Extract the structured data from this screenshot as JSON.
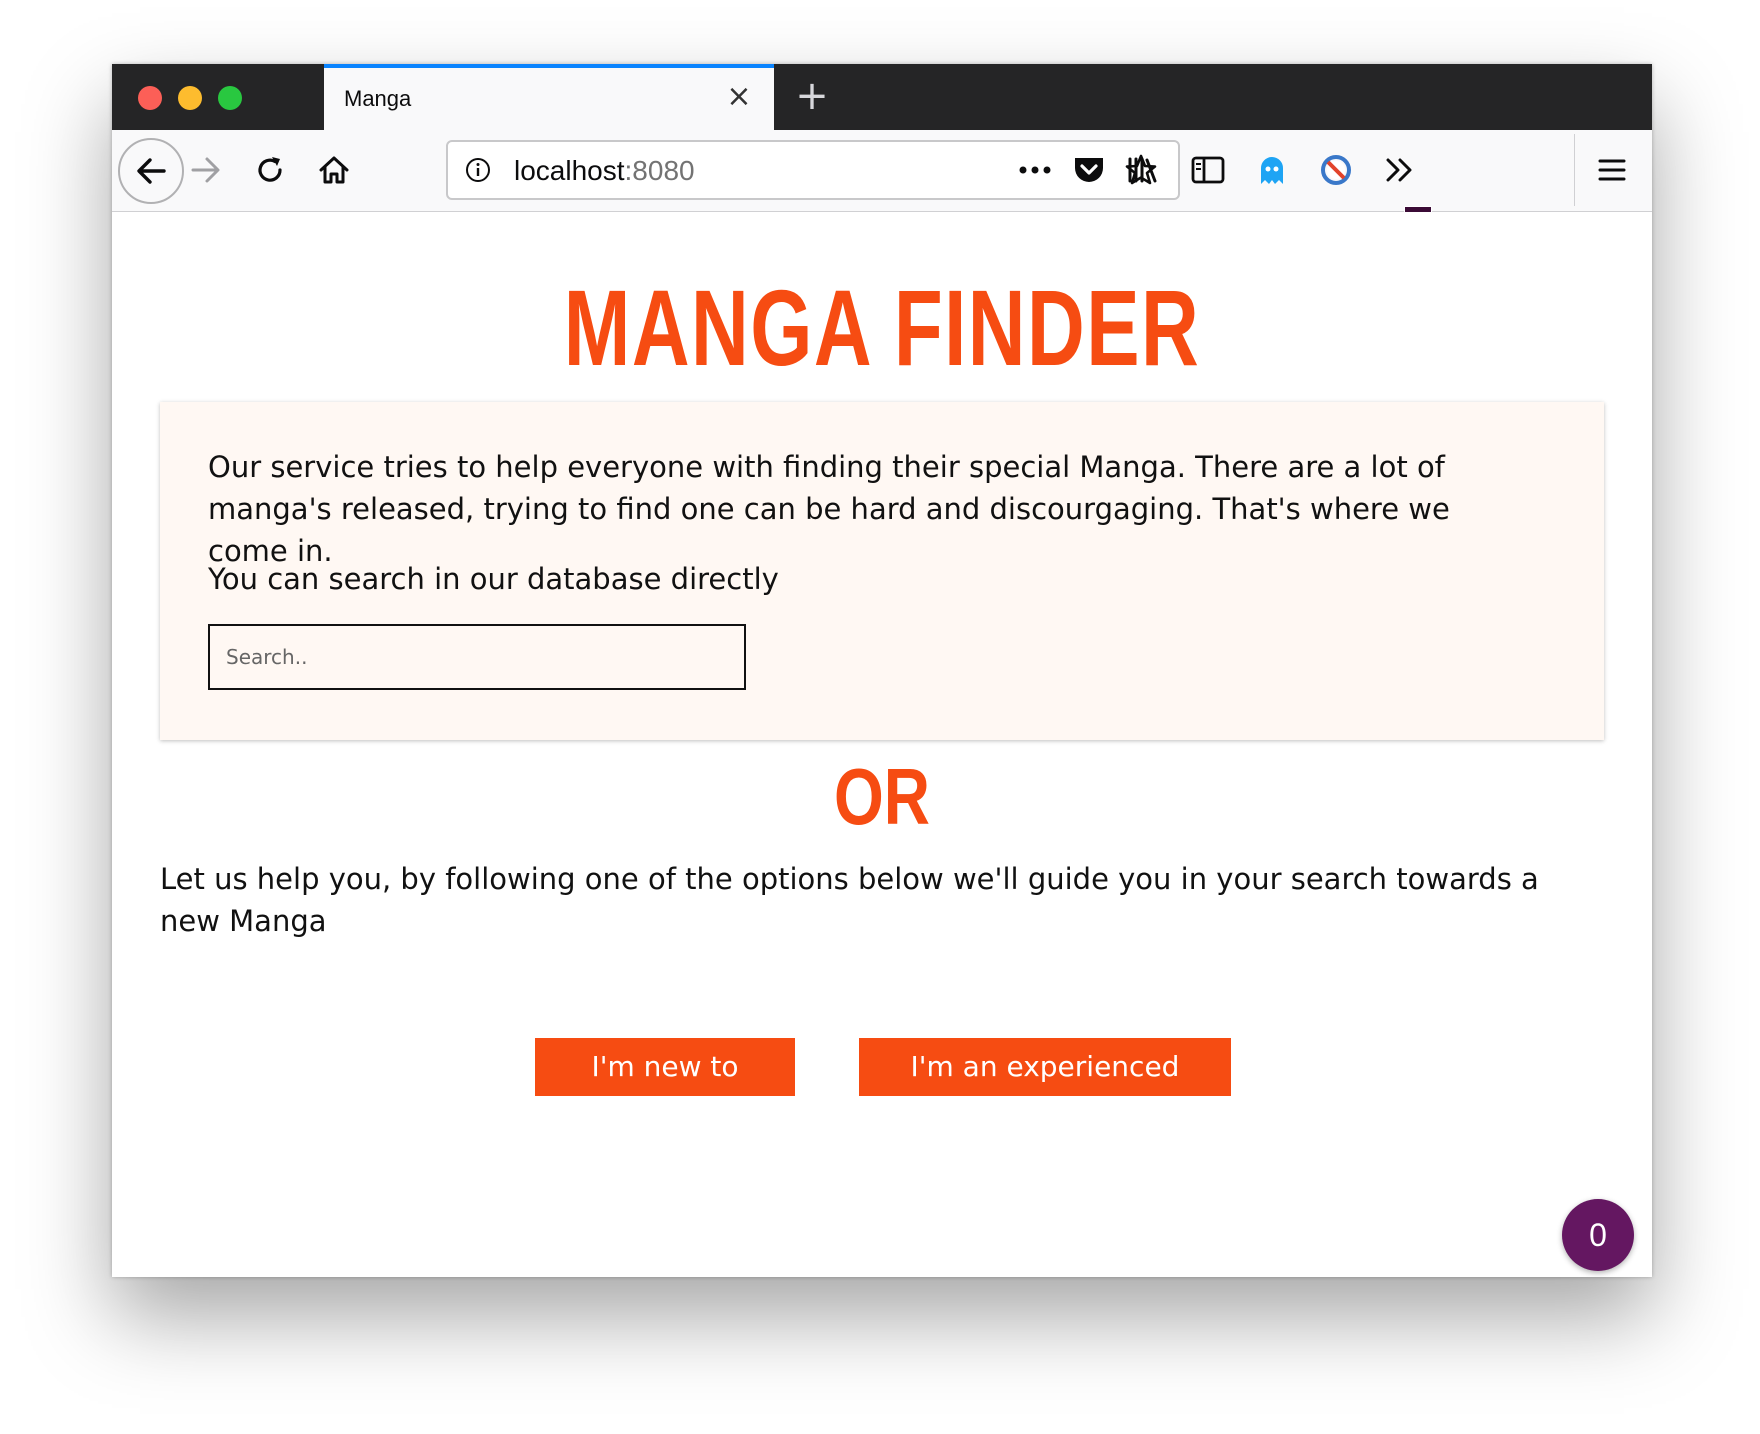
{
  "browser": {
    "tab_title": "Manga",
    "url_host": "localhost",
    "url_port": ":8080",
    "badge_count": "0"
  },
  "page": {
    "title": "MANGA FINDER",
    "intro": "Our service tries to help everyone with finding their special Manga. There are a lot of manga's released, trying to find one can be hard and discourgaging. That's where we come in.",
    "search_label": "You can search in our database directly",
    "search_placeholder": "Search..",
    "or_label": "OR",
    "guide_text": "Let us help you, by following one of the options below we'll guide you in your search towards a new Manga",
    "new_button": "I'm new to Manga",
    "experienced_button": "I'm an experienced reader",
    "fab_count": "0"
  },
  "colors": {
    "accent": "#f64c12",
    "box_background": "#fff8f3",
    "fab": "#641761",
    "tab_highlight": "#0a84ff"
  },
  "icons": {
    "toolbar": [
      "back-arrow-icon",
      "forward-arrow-icon",
      "reload-icon",
      "home-icon",
      "info-icon",
      "more-icon",
      "pocket-icon",
      "bookmark-star-icon",
      "library-icon",
      "sidebar-icon",
      "ghostery-icon",
      "block-icon",
      "overflow-icon",
      "menu-icon"
    ]
  }
}
